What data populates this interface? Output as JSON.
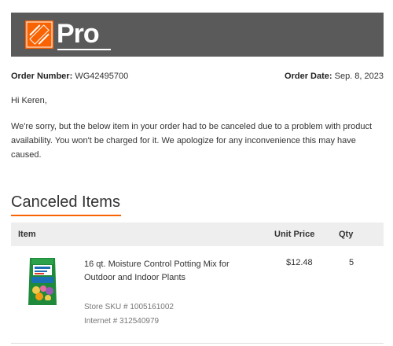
{
  "header": {
    "logo_text": "Pro",
    "brand_colors": {
      "orange": "#f96302",
      "header_bg": "#5a5a5a"
    }
  },
  "order": {
    "number_label": "Order Number:",
    "number_value": "WG42495700",
    "date_label": "Order Date:",
    "date_value": "Sep. 8, 2023"
  },
  "greeting": "Hi Keren,",
  "message": "We're sorry, but the below item in your order had to be canceled due to a problem with product availability. You won't be charged for it. We apologize for any inconvenience this may have caused.",
  "section_title": "Canceled Items",
  "table": {
    "headers": {
      "item": "Item",
      "unit_price": "Unit Price",
      "qty": "Qty"
    },
    "rows": [
      {
        "image_icon": "potting-mix-bag",
        "name": "16 qt. Moisture Control Potting Mix for Outdoor and Indoor Plants",
        "unit_price": "$12.48",
        "qty": "5",
        "store_sku": "Store SKU # 1005161002",
        "internet_id": "Internet # 312540979"
      }
    ]
  }
}
